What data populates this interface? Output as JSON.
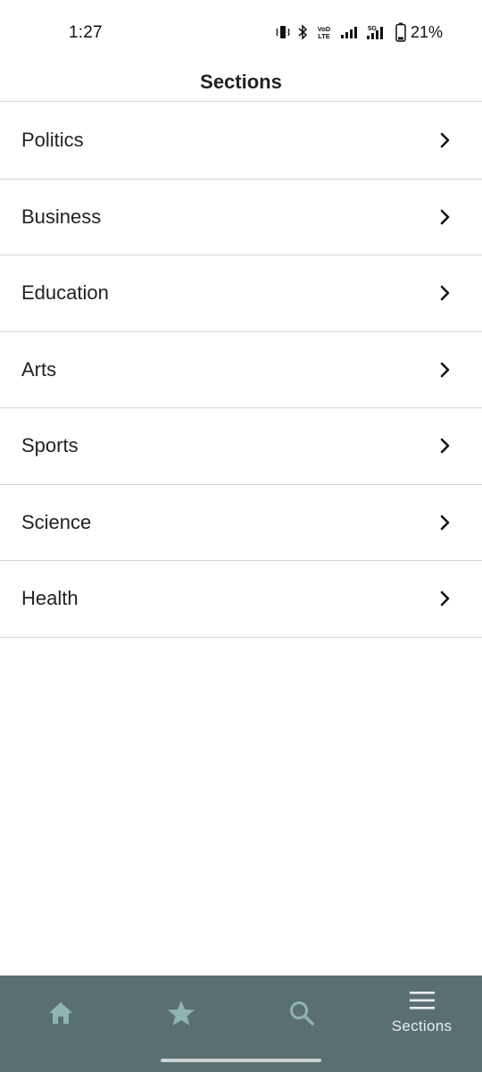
{
  "status_bar": {
    "time": "1:27",
    "battery_percent": "21%",
    "icons": [
      "vibrate-icon",
      "bluetooth-icon",
      "volte-icon",
      "signal-icon",
      "5g-signal-icon",
      "battery-icon"
    ],
    "volte_text": "VoLTE",
    "network_text": "5G"
  },
  "header": {
    "title": "Sections"
  },
  "sections": [
    {
      "label": "Politics"
    },
    {
      "label": "Business"
    },
    {
      "label": "Education"
    },
    {
      "label": "Arts"
    },
    {
      "label": "Sports"
    },
    {
      "label": "Science"
    },
    {
      "label": "Health"
    }
  ],
  "bottom_nav": {
    "items": [
      {
        "icon": "home-icon",
        "label": ""
      },
      {
        "icon": "star-icon",
        "label": ""
      },
      {
        "icon": "search-icon",
        "label": ""
      },
      {
        "icon": "menu-icon",
        "label": "Sections"
      }
    ],
    "active_index": 3
  },
  "colors": {
    "nav_background": "#5a6f72",
    "nav_icon_inactive": "#8fb5b2",
    "nav_icon_active": "#e8eeee",
    "divider": "#d6d6d6"
  }
}
